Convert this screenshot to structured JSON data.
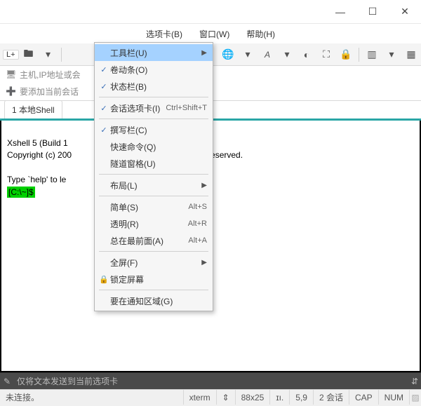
{
  "titlebar": {
    "title": ""
  },
  "menubar": {
    "tabs": "选项卡(B)",
    "window": "窗口(W)",
    "help": "帮助(H)"
  },
  "toolbar": {
    "new_label": "L+"
  },
  "sidebar": {
    "host_placeholder": "主机,IP地址或会",
    "add_current": "要添加当前会话"
  },
  "tab": {
    "local_shell": "1 本地Shell"
  },
  "terminal": {
    "line1": "Xshell 5 (Build 1",
    "line2a": "Copyright (c) 200",
    "line2b": "c. All rights reserved.",
    "line3": "Type `help' to le",
    "prompt": "[C:\\~]$"
  },
  "popup": {
    "items": {
      "toolbar": "工具栏(U)",
      "scrollbar": "卷动条(O)",
      "statusbar": "状态栏(B)",
      "session_tabs": "会话选项卡(I)",
      "session_tabs_acc": "Ctrl+Shift+T",
      "compose": "撰写栏(C)",
      "quickcmd": "快速命令(Q)",
      "tunnel": "隧道窗格(U)",
      "layout": "布局(L)",
      "simple": "简单(S)",
      "simple_acc": "Alt+S",
      "transparent": "透明(R)",
      "transparent_acc": "Alt+R",
      "always_top": "总在最前面(A)",
      "always_top_acc": "Alt+A",
      "fullscreen": "全屏(F)",
      "lock": "锁定屏幕",
      "notify": "要在通知区域(G)"
    }
  },
  "bottom": {
    "send_text": "仅将文本发送到当前选项卡"
  },
  "status": {
    "conn": "未连接。",
    "term": "xterm",
    "arrows": "⇕",
    "size": "88x25",
    "li": "ɪı.",
    "cursor": "5,9",
    "sessions": "2 会话",
    "cap": "CAP",
    "num": "NUM"
  }
}
